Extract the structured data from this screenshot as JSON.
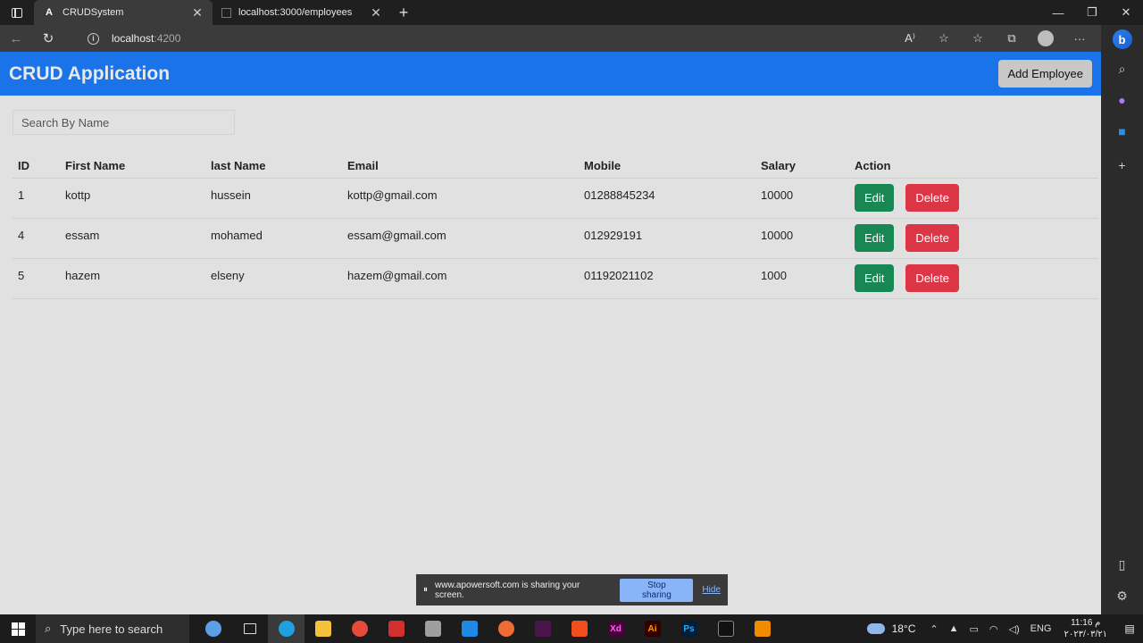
{
  "browser": {
    "tabs": [
      {
        "title": "CRUDSystem",
        "favicon": "A"
      },
      {
        "title": "localhost:3000/employees"
      }
    ],
    "url_host": "localhost",
    "url_port": ":4200"
  },
  "app": {
    "title": "CRUD Application",
    "add_button": "Add Employee",
    "search_placeholder": "Search By Name"
  },
  "table": {
    "headers": [
      "ID",
      "First Name",
      "last Name",
      "Email",
      "Mobile",
      "Salary",
      "Action"
    ],
    "rows": [
      {
        "id": "1",
        "first": "kottp",
        "last": "hussein",
        "email": "kottp@gmail.com",
        "mobile": "01288845234",
        "salary": "10000"
      },
      {
        "id": "4",
        "first": "essam",
        "last": "mohamed",
        "email": "essam@gmail.com",
        "mobile": "012929191",
        "salary": "10000"
      },
      {
        "id": "5",
        "first": "hazem",
        "last": "elseny",
        "email": "hazem@gmail.com",
        "mobile": "01192021102",
        "salary": "1000"
      }
    ],
    "edit_label": "Edit",
    "delete_label": "Delete"
  },
  "sharebar": {
    "message": "www.apowersoft.com is sharing your screen.",
    "stop": "Stop sharing",
    "hide": "Hide"
  },
  "taskbar": {
    "search_placeholder": "Type here to search",
    "temperature": "18°C",
    "language": "ENG",
    "time": "11:16 م",
    "date": "٢٠٢٣/٠٣/٢١"
  },
  "colors": {
    "header": "#1a73e8",
    "edit": "#198754",
    "delete": "#dc3545"
  }
}
